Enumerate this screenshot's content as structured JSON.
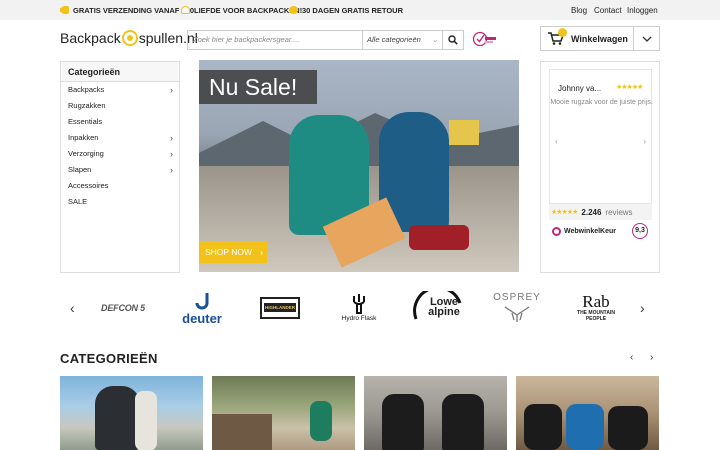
{
  "topbar": {
    "usps": [
      "GRATIS VERZENDING VANAF €30",
      "LIEFDE VOOR BACKPACKEN!",
      "30 DAGEN GRATIS RETOUR"
    ],
    "links": [
      "Blog",
      "Contact",
      "Inloggen"
    ]
  },
  "header": {
    "logo_left": "Backpack",
    "logo_right": "spullen.nl",
    "search_placeholder": "Zoek hier je backpackersgear....",
    "category_select": "Alle categorieën",
    "cart_label": "Winkelwagen",
    "cart_count": ""
  },
  "sidebar": {
    "title": "Categorieën",
    "items": [
      {
        "label": "Backpacks",
        "has_sub": true
      },
      {
        "label": "Rugzakken",
        "has_sub": false
      },
      {
        "label": "Essentials",
        "has_sub": false
      },
      {
        "label": "Inpakken",
        "has_sub": true
      },
      {
        "label": "Verzorging",
        "has_sub": true
      },
      {
        "label": "Slapen",
        "has_sub": true
      },
      {
        "label": "Accessoires",
        "has_sub": false
      },
      {
        "label": "SALE",
        "has_sub": false
      }
    ]
  },
  "hero": {
    "title": "Nu Sale!",
    "button": "SHOP NOW"
  },
  "review": {
    "name": "Johnny va...",
    "stars": "★★★★★",
    "text": "Mooie rugzak voor de juiste prijs.",
    "summary_stars": "★★★★★",
    "count": "2.246",
    "count_label": "reviews",
    "brand": "WebwinkelKeur",
    "score": "9,3"
  },
  "brands": [
    "DEFCON 5",
    "deuter",
    "HIGHLANDER",
    "Hydro Flask",
    "Lowe alpine",
    "OSPREY",
    "Rab"
  ],
  "brand_sub": {
    "rab": "THE MOUNTAIN PEOPLE"
  },
  "section": {
    "title": "CATEGORIEËN"
  },
  "colors": {
    "accent": "#f2c21b",
    "keur": "#c0277a"
  }
}
